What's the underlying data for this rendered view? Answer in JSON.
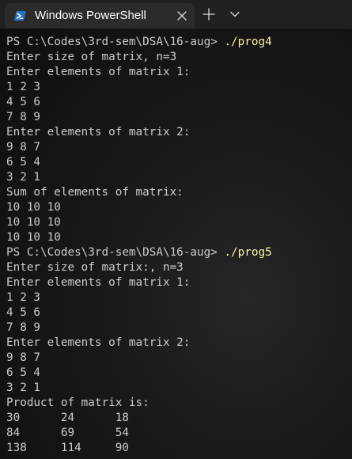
{
  "tab": {
    "title": "Windows PowerShell",
    "icon": "powershell-icon",
    "close_icon": "close-icon",
    "new_tab_icon": "plus-icon",
    "dropdown_icon": "chevron-down-icon"
  },
  "colors": {
    "background": "#0c0c0c",
    "tabbar": "#202020",
    "tab_active": "#2b2b2b",
    "text": "#cccccc",
    "command": "#f9f1a5",
    "powershell_icon": "#2671be"
  },
  "terminal": {
    "lines": [
      {
        "prompt": "PS C:\\Codes\\3rd-sem\\DSA\\16-aug> ",
        "command": "./prog4"
      },
      {
        "text": "Enter size of matrix, n=3"
      },
      {
        "text": "Enter elements of matrix 1:"
      },
      {
        "text": "1 2 3"
      },
      {
        "text": "4 5 6"
      },
      {
        "text": "7 8 9"
      },
      {
        "text": "Enter elements of matrix 2:"
      },
      {
        "text": "9 8 7"
      },
      {
        "text": "6 5 4"
      },
      {
        "text": "3 2 1"
      },
      {
        "text": "Sum of elements of matrix:"
      },
      {
        "text": "10 10 10"
      },
      {
        "text": "10 10 10"
      },
      {
        "text": "10 10 10"
      },
      {
        "prompt": "PS C:\\Codes\\3rd-sem\\DSA\\16-aug> ",
        "command": "./prog5"
      },
      {
        "text": "Enter size of matrix:, n=3"
      },
      {
        "text": "Enter elements of matrix 1:"
      },
      {
        "text": "1 2 3"
      },
      {
        "text": "4 5 6"
      },
      {
        "text": "7 8 9"
      },
      {
        "text": "Enter elements of matrix 2:"
      },
      {
        "text": "9 8 7"
      },
      {
        "text": "6 5 4"
      },
      {
        "text": "3 2 1"
      },
      {
        "text": "Product of matrix is:"
      },
      {
        "text": "30      24      18"
      },
      {
        "text": "84      69      54"
      },
      {
        "text": "138     114     90"
      }
    ]
  }
}
